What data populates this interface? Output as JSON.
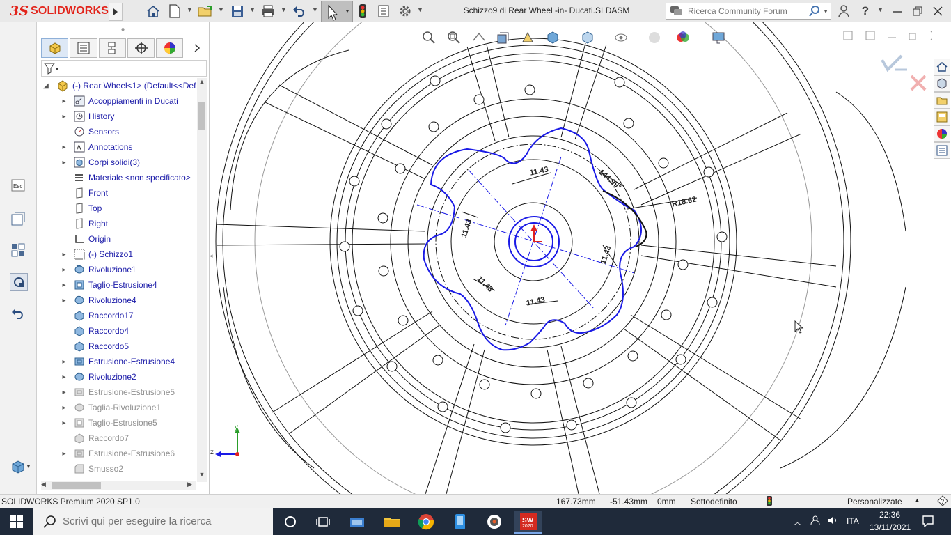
{
  "app": {
    "logo_ds": "3S",
    "logo_text": "SOLIDWORKS",
    "document_title": "Schizzo9 di Rear Wheel -in- Ducati.SLDASM",
    "search_placeholder": "Ricerca Community Forum"
  },
  "feature_tree": {
    "root": "(-) Rear Wheel<1> (Default<<Def",
    "items": [
      {
        "label": "Accoppiamenti in Ducati",
        "icon": "mates-icon",
        "expand": "▸",
        "style": "blue"
      },
      {
        "label": "History",
        "icon": "history-icon",
        "expand": "▸",
        "style": "blue"
      },
      {
        "label": "Sensors",
        "icon": "sensor-icon",
        "expand": "",
        "style": "blue"
      },
      {
        "label": "Annotations",
        "icon": "annotation-icon",
        "expand": "▸",
        "style": "blue"
      },
      {
        "label": "Corpi solidi(3)",
        "icon": "solid-bodies-icon",
        "expand": "▸",
        "style": "blue"
      },
      {
        "label": "Materiale <non specificato>",
        "icon": "material-icon",
        "expand": "",
        "style": "blue"
      },
      {
        "label": "Front",
        "icon": "plane-icon",
        "expand": "",
        "style": "blue"
      },
      {
        "label": "Top",
        "icon": "plane-icon",
        "expand": "",
        "style": "blue"
      },
      {
        "label": "Right",
        "icon": "plane-icon",
        "expand": "",
        "style": "blue"
      },
      {
        "label": "Origin",
        "icon": "origin-icon",
        "expand": "",
        "style": "blue"
      },
      {
        "label": "(-) Schizzo1",
        "icon": "sketch-icon",
        "expand": "▸",
        "style": "blue"
      },
      {
        "label": "Rivoluzione1",
        "icon": "revolve-icon",
        "expand": "▸",
        "style": "blue"
      },
      {
        "label": "Taglio-Estrusione4",
        "icon": "cut-extrude-icon",
        "expand": "▸",
        "style": "blue"
      },
      {
        "label": "Rivoluzione4",
        "icon": "revolve-icon",
        "expand": "▸",
        "style": "blue"
      },
      {
        "label": "Raccordo17",
        "icon": "fillet-icon",
        "expand": "",
        "style": "blue"
      },
      {
        "label": "Raccordo4",
        "icon": "fillet-icon",
        "expand": "",
        "style": "blue"
      },
      {
        "label": "Raccordo5",
        "icon": "fillet-icon",
        "expand": "",
        "style": "blue"
      },
      {
        "label": "Estrusione-Estrusione4",
        "icon": "extrude-icon",
        "expand": "▸",
        "style": "blue"
      },
      {
        "label": "Rivoluzione2",
        "icon": "revolve-icon",
        "expand": "▸",
        "style": "blue"
      },
      {
        "label": "Estrusione-Estrusione5",
        "icon": "extrude-icon",
        "expand": "▸",
        "style": "grey"
      },
      {
        "label": "Taglia-Rivoluzione1",
        "icon": "cut-revolve-icon",
        "expand": "▸",
        "style": "grey"
      },
      {
        "label": "Taglio-Estrusione5",
        "icon": "cut-extrude-icon",
        "expand": "▸",
        "style": "grey"
      },
      {
        "label": "Raccordo7",
        "icon": "fillet-icon",
        "expand": "",
        "style": "grey"
      },
      {
        "label": "Estrusione-Estrusione6",
        "icon": "extrude-icon",
        "expand": "▸",
        "style": "grey"
      },
      {
        "label": "Smusso2",
        "icon": "chamfer-icon",
        "expand": "",
        "style": "grey"
      }
    ]
  },
  "dimensions": {
    "d1": "11.43",
    "d2": "11.43",
    "d3": "11.43",
    "d4": "11.43",
    "d5": "11.43",
    "d6": "11.43",
    "angle": "144.99°",
    "radius": "R18.62"
  },
  "triad": {
    "z_label": "z",
    "y_label": "y"
  },
  "status": {
    "product": "SOLIDWORKS Premium 2020 SP1.0",
    "x": "167.73mm",
    "y": "-51.43mm",
    "z": "0mm",
    "state": "Sottodefinito",
    "units": "Personalizzate"
  },
  "taskbar": {
    "search_placeholder": "Scrivi qui per eseguire la ricerca",
    "sw_badge": "2020",
    "language": "ITA",
    "time": "22:36",
    "date": "13/11/2021"
  },
  "colors": {
    "sketch_blue": "#1a1ae6",
    "logo_red": "#e2231a",
    "taskbar": "#1f2a3a"
  }
}
